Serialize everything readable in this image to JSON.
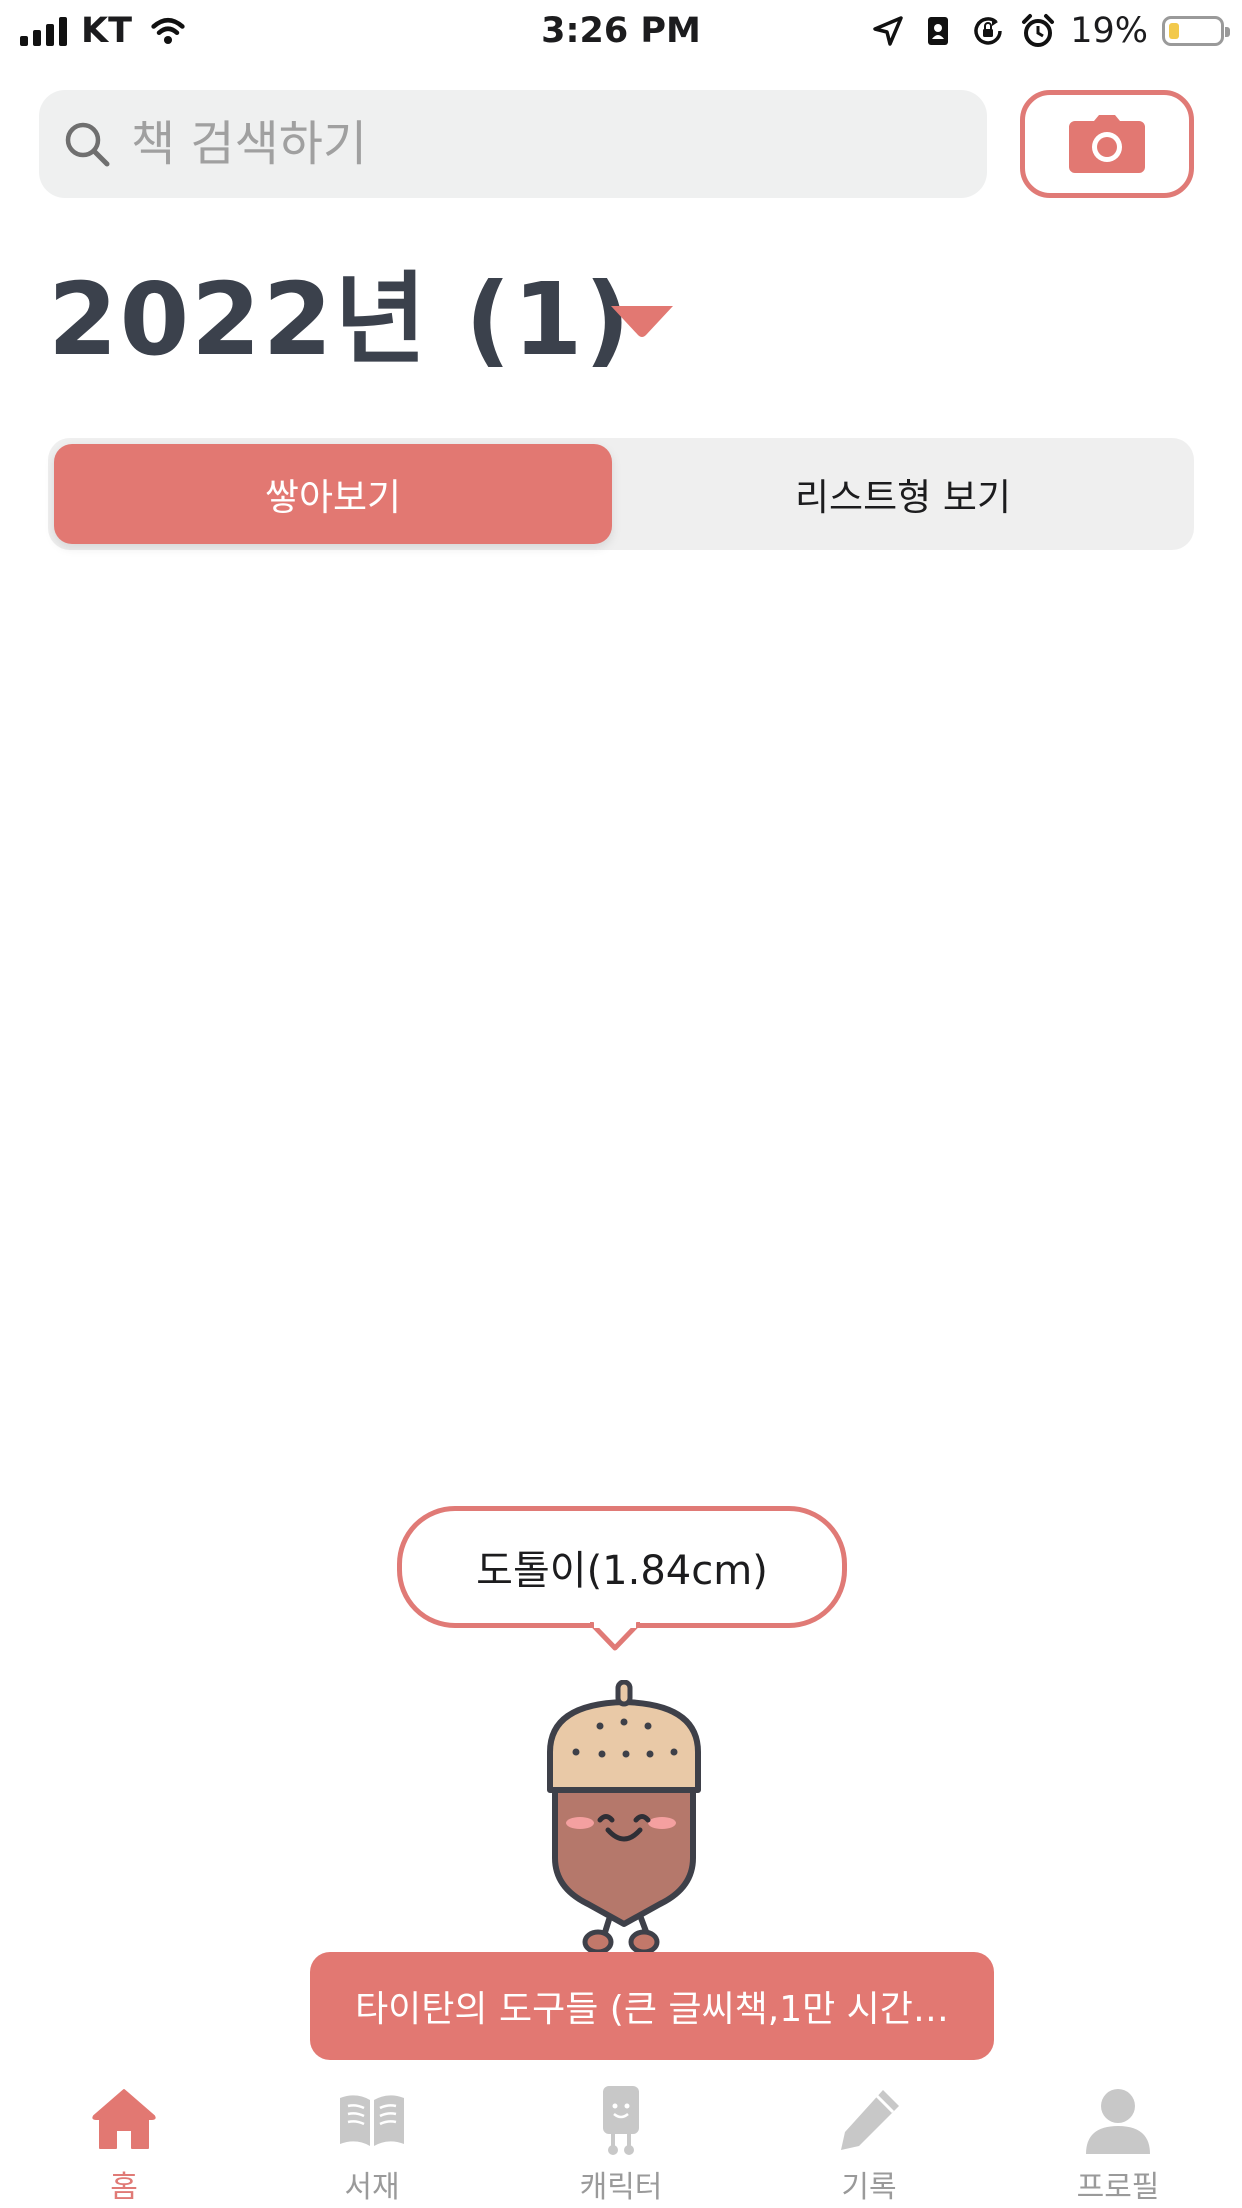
{
  "status_bar": {
    "carrier": "KT",
    "time": "3:26 PM",
    "battery_percent": "19%",
    "battery_level": 0.19,
    "icons": [
      "signal-icon",
      "wifi-icon",
      "location-icon",
      "contact-icon",
      "orientation-lock-icon",
      "alarm-icon",
      "battery-icon"
    ]
  },
  "search": {
    "placeholder": "책 검색하기",
    "value": "",
    "icon": "search-icon"
  },
  "camera_button": {
    "icon": "camera-icon"
  },
  "header": {
    "year_title": "2022년 (1)",
    "dropdown_icon": "caret-down-icon"
  },
  "view_toggle": {
    "stack_label": "쌓아보기",
    "list_label": "리스트형 보기",
    "selected": "쌓아보기"
  },
  "character": {
    "bubble_text": "도톨이(1.84cm)",
    "icon": "acorn-character"
  },
  "book_banner": {
    "title": "타이탄의 도구들 (큰 글씨책,1만 시간…"
  },
  "tab_bar": {
    "items": [
      {
        "label": "홈",
        "icon": "home-icon",
        "active": true
      },
      {
        "label": "서재",
        "icon": "book-icon",
        "active": false
      },
      {
        "label": "캐릭터",
        "icon": "character-icon",
        "active": false
      },
      {
        "label": "기록",
        "icon": "pencil-icon",
        "active": false
      },
      {
        "label": "프로필",
        "icon": "profile-icon",
        "active": false
      }
    ]
  },
  "colors": {
    "accent": "#e27872",
    "title_text": "#3b414c",
    "search_bg": "#eff0f0",
    "inactive_tab": "#c8c8c8"
  }
}
